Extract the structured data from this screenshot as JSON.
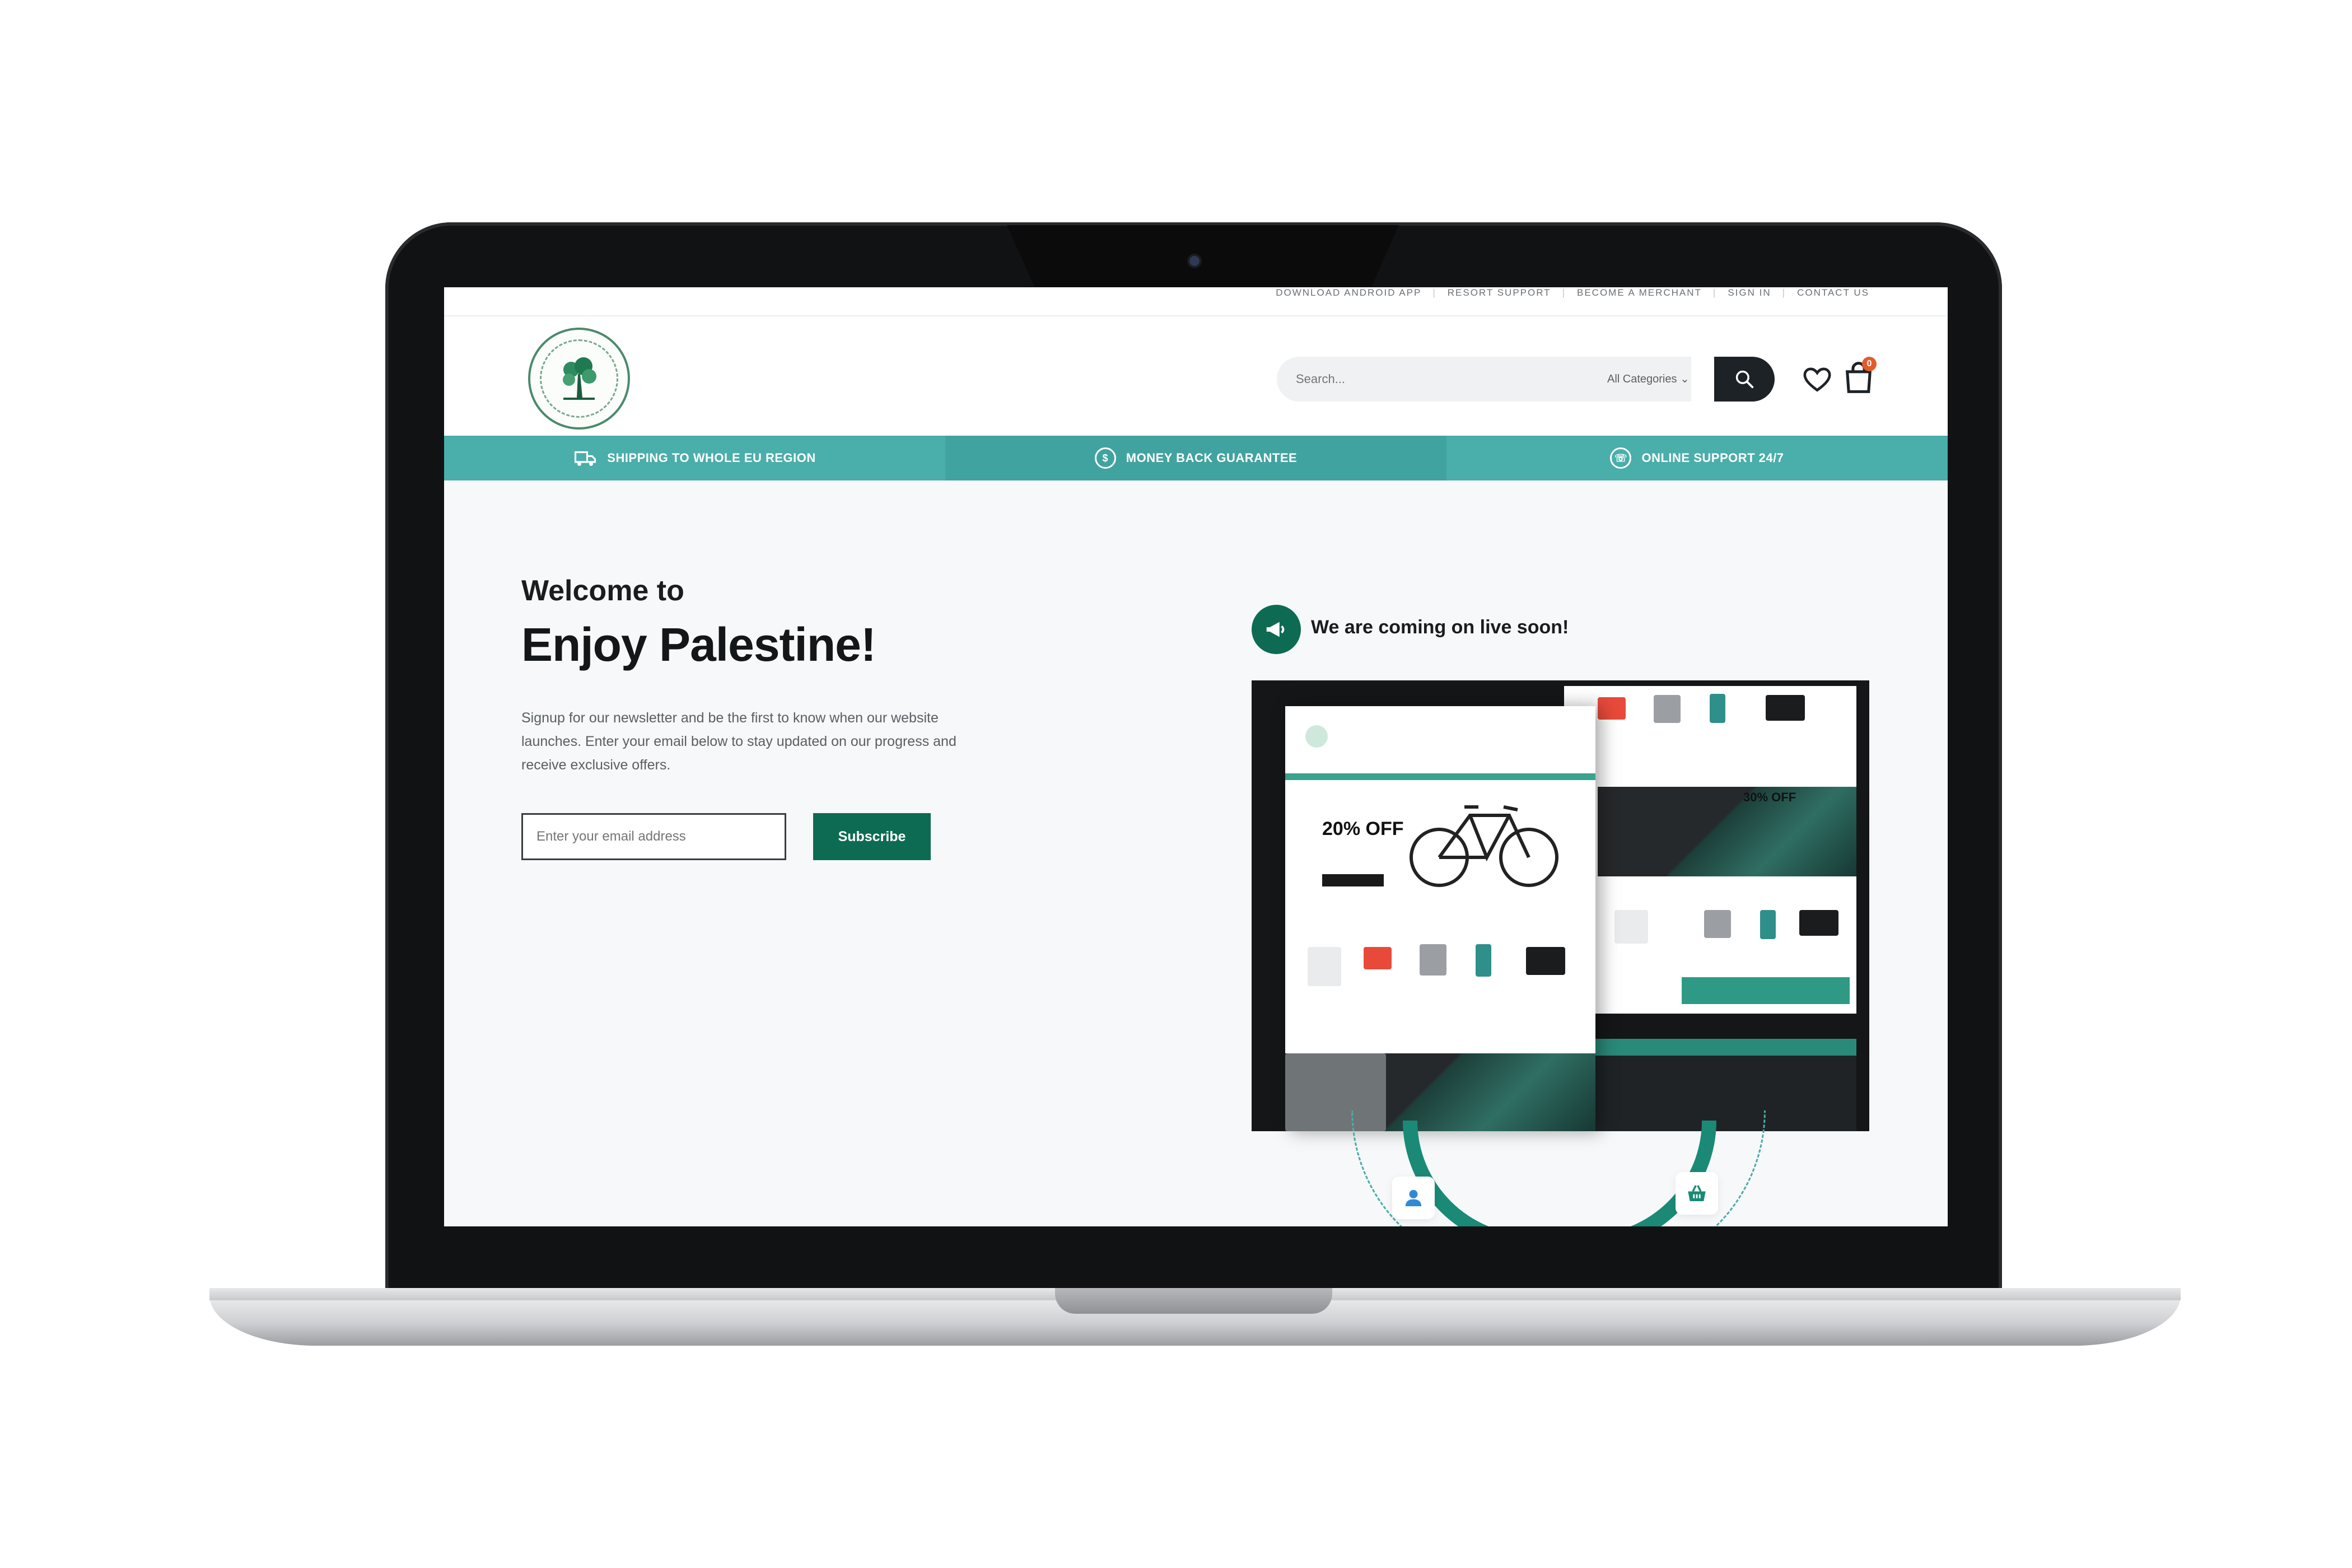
{
  "topbar": {
    "links": [
      "DOWNLOAD ANDROID APP",
      "RESORT SUPPORT",
      "BECOME A MERCHANT",
      "SIGN IN",
      "CONTACT US"
    ]
  },
  "header": {
    "search_placeholder": "Search...",
    "category_label": "All Categories",
    "cart_count": "0"
  },
  "benefits": [
    {
      "label": "SHIPPING TO WHOLE EU REGION",
      "icon": "truck-icon"
    },
    {
      "label": "MONEY BACK GUARANTEE",
      "icon": "coin-icon"
    },
    {
      "label": "ONLINE SUPPORT 24/7",
      "icon": "support-icon"
    }
  ],
  "hero": {
    "welcome": "Welcome to",
    "title": "Enjoy Palestine!",
    "text": "Signup for our newsletter and be the first to know when our website launches. Enter your email below to stay updated on our progress and receive exclusive offers.",
    "email_placeholder": "Enter your email address",
    "subscribe_label": "Subscribe"
  },
  "announcement": {
    "text": "We are coming on live soon!"
  },
  "preview": {
    "promo": "20% OFF",
    "promo2": "30% OFF"
  },
  "colors": {
    "brand_green": "#0d6b53",
    "teal_bar": "#4aaeaa",
    "dark": "#1d2226",
    "badge": "#e25c2a"
  }
}
